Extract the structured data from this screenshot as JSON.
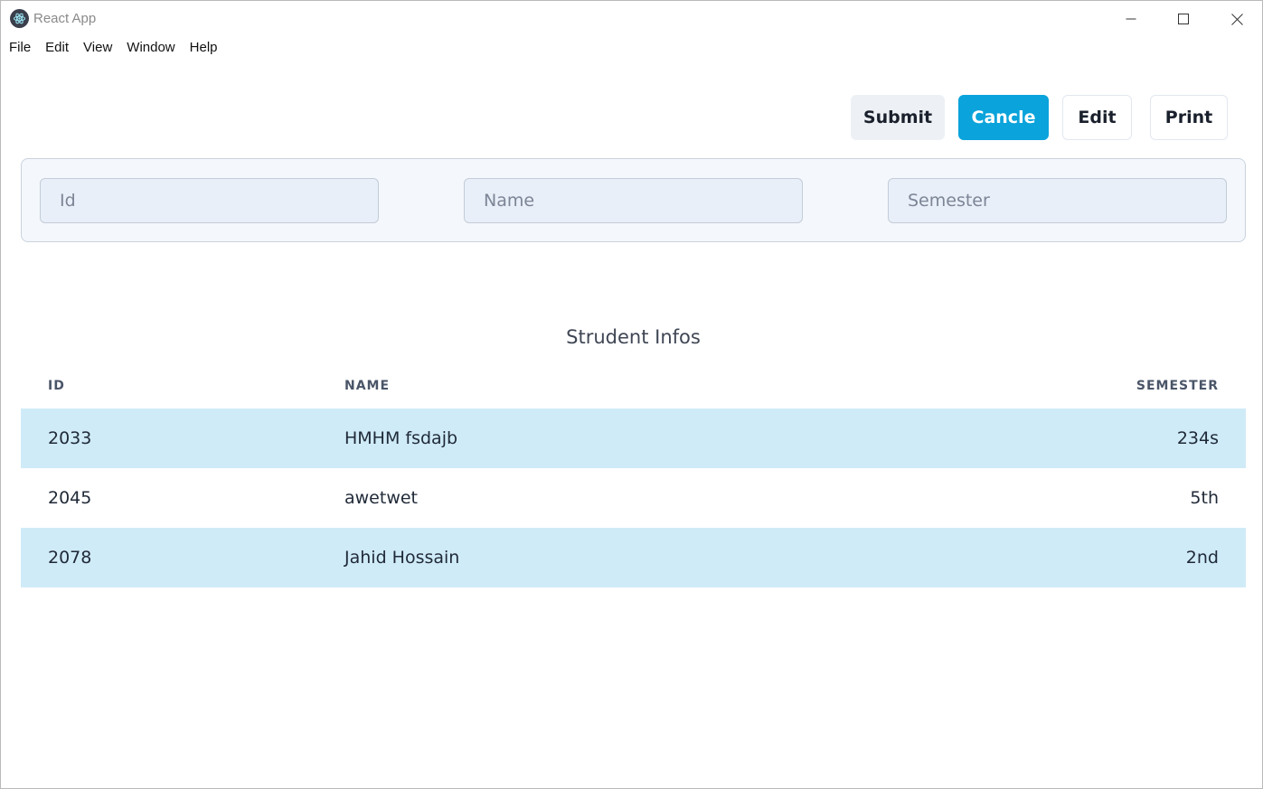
{
  "window": {
    "title": "React App",
    "icon": "electron-atom-icon",
    "controls": [
      "minimize-icon",
      "maximize-icon",
      "close-icon"
    ]
  },
  "menu": {
    "items": [
      "File",
      "Edit",
      "View",
      "Window",
      "Help"
    ]
  },
  "actions": {
    "submit_label": "Submit",
    "cancel_label": "Cancle",
    "edit_label": "Edit",
    "print_label": "Print",
    "accent_color": "#0aa3db"
  },
  "form": {
    "id": {
      "value": "",
      "placeholder": "Id"
    },
    "name": {
      "value": "",
      "placeholder": "Name"
    },
    "semester": {
      "value": "",
      "placeholder": "Semester"
    }
  },
  "table": {
    "caption": "Strudent Infos",
    "headers": {
      "id": "ID",
      "name": "NAME",
      "semester": "SEMESTER"
    },
    "stripe_color": "#d0ebf8",
    "rows": [
      {
        "id": "2033",
        "name": "HMHM fsdajb",
        "semester": "234s"
      },
      {
        "id": "2045",
        "name": "awetwet",
        "semester": "5th"
      },
      {
        "id": "2078",
        "name": "Jahid Hossain",
        "semester": "2nd"
      }
    ]
  }
}
